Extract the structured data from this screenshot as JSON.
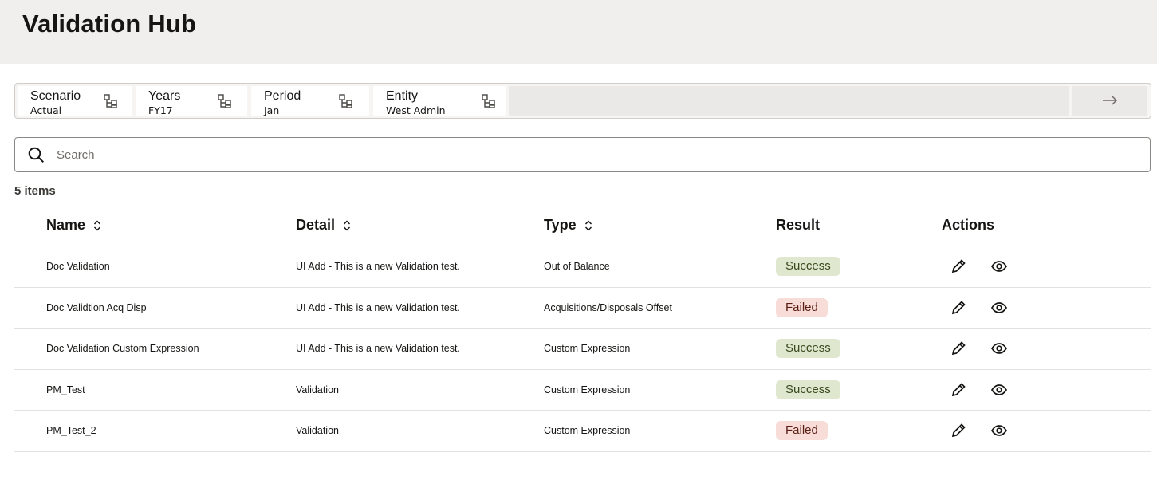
{
  "page": {
    "title": "Validation Hub"
  },
  "pov": {
    "items": [
      {
        "label": "Scenario",
        "value": "Actual",
        "icon": "member-selector-icon"
      },
      {
        "label": "Years",
        "value": "FY17",
        "icon": "member-selector-icon"
      },
      {
        "label": "Period",
        "value": "Jan",
        "icon": "member-selector-icon"
      },
      {
        "label": "Entity",
        "value": "West Admin",
        "icon": "member-selector-icon"
      }
    ],
    "go_icon": "arrow-right-icon"
  },
  "search": {
    "placeholder": "Search",
    "value": ""
  },
  "table": {
    "count_label": "5 items",
    "columns": {
      "name": "Name",
      "detail": "Detail",
      "type": "Type",
      "result": "Result",
      "actions": "Actions"
    },
    "rows": [
      {
        "name": "Doc Validation",
        "detail": "UI Add - This is a new Validation test.",
        "type": "Out of Balance",
        "result": "Success"
      },
      {
        "name": "Doc Validtion Acq Disp",
        "detail": "UI Add - This is a new Validation test.",
        "type": "Acquisitions/Disposals Offset",
        "result": "Failed"
      },
      {
        "name": "Doc Validation Custom Expression",
        "detail": "UI Add - This is a new Validation test.",
        "type": "Custom Expression",
        "result": "Success"
      },
      {
        "name": "PM_Test",
        "detail": "Validation",
        "type": "Custom Expression",
        "result": "Success"
      },
      {
        "name": "PM_Test_2",
        "detail": "Validation",
        "type": "Custom Expression",
        "result": "Failed"
      }
    ]
  },
  "colors": {
    "header_bg": "#f1efed",
    "success_bg": "#dfe7cf",
    "failed_bg": "#f8dcd7"
  }
}
